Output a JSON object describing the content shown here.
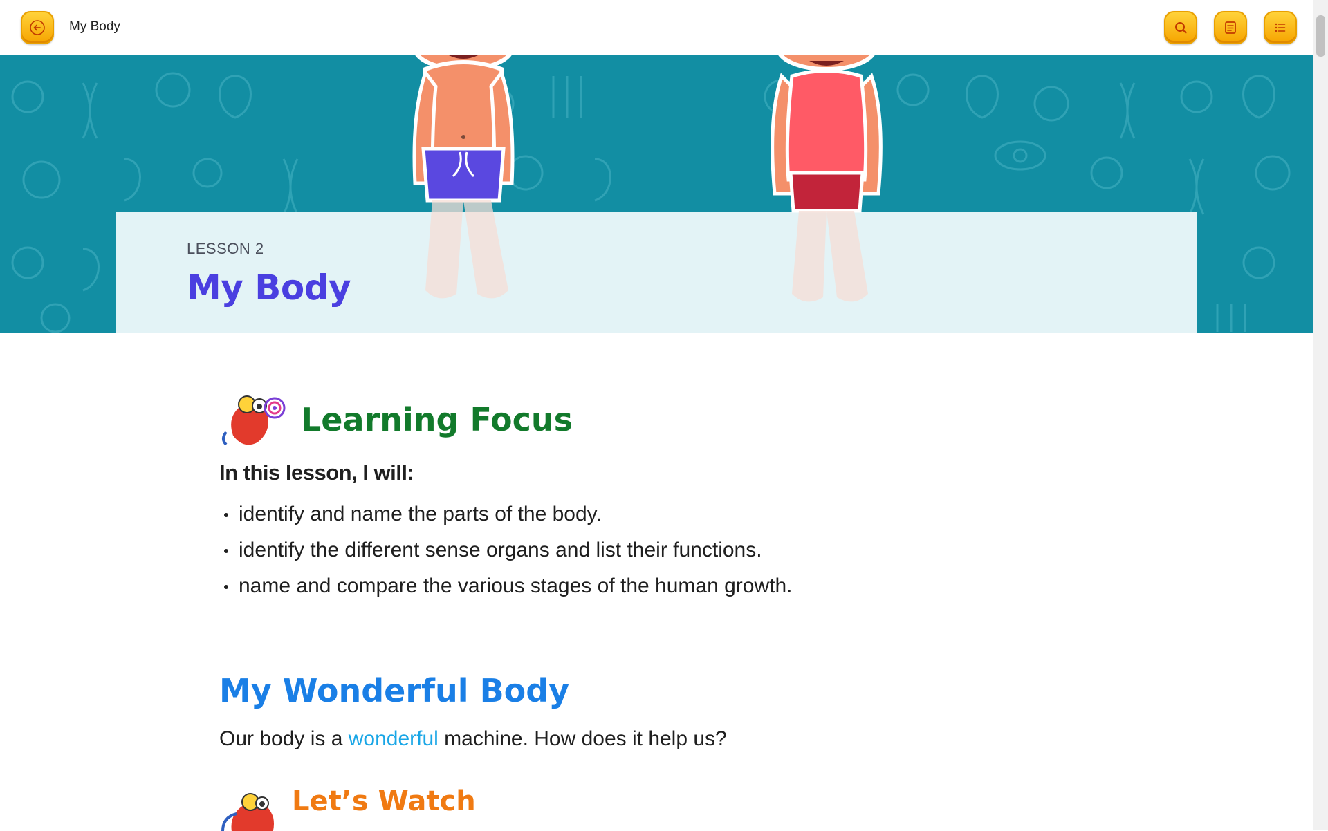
{
  "app": {
    "title": "My Body"
  },
  "toolbar": {
    "back_icon": "arrow-left-icon",
    "search_icon": "search-icon",
    "notes_icon": "note-icon",
    "toc_icon": "list-icon"
  },
  "hero": {
    "lesson_label": "LESSON 2",
    "lesson_title": "My Body"
  },
  "learning_focus": {
    "heading": "Learning Focus",
    "intro": "In this lesson, I will:",
    "items": [
      "identify and name the parts of the body.",
      "identify the different sense organs and list their functions.",
      "name and compare the various stages of the human growth."
    ]
  },
  "section": {
    "heading": "My Wonderful Body",
    "text_before": "Our body is a ",
    "highlight": "wonderful",
    "text_after": " machine. How does it help us?"
  },
  "watch": {
    "heading": "Let’s Watch"
  },
  "colors": {
    "accent_yellow": "#f6a400",
    "hero_teal": "#128ea3",
    "lesson_title": "#4a3fe0",
    "focus_green": "#127a2b",
    "section_blue": "#1a7fe6",
    "watch_orange": "#f07a12"
  }
}
